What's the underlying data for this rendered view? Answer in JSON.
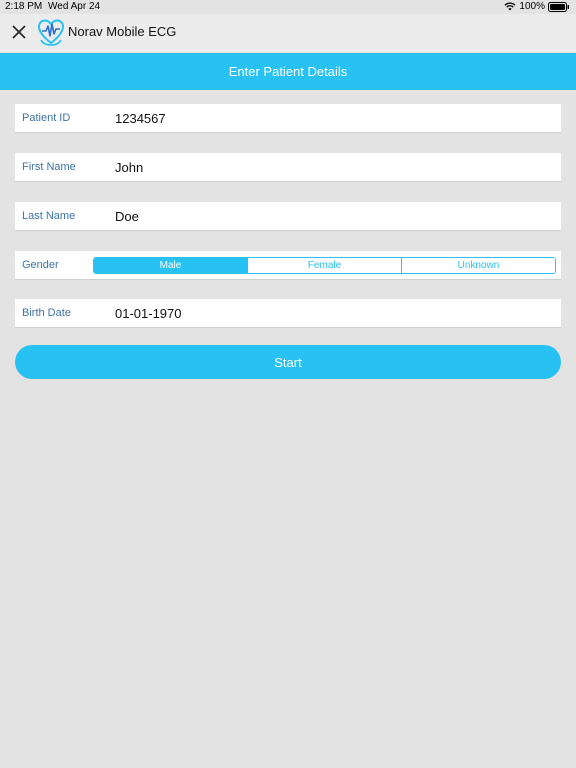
{
  "status_bar": {
    "time": "2:18 PM",
    "date": "Wed Apr 24",
    "battery": "100%"
  },
  "app_bar": {
    "title": "Norav Mobile ECG",
    "close_icon": "close-icon",
    "logo_icon": "heart-ecg-logo-icon"
  },
  "section": {
    "title": "Enter Patient Details"
  },
  "form": {
    "patient_id": {
      "label": "Patient ID",
      "value": "1234567"
    },
    "first_name": {
      "label": "First Name",
      "value": "John"
    },
    "last_name": {
      "label": "Last Name",
      "value": "Doe"
    },
    "gender": {
      "label": "Gender",
      "options": [
        "Male",
        "Female",
        "Unknown"
      ],
      "selected": "Male"
    },
    "birth_date": {
      "label": "Birth Date",
      "value": "01-01-1970"
    }
  },
  "start_label": "Start",
  "colors": {
    "accent": "#27c1f3",
    "label": "#3d73a8",
    "background": "#e3e3e3"
  }
}
